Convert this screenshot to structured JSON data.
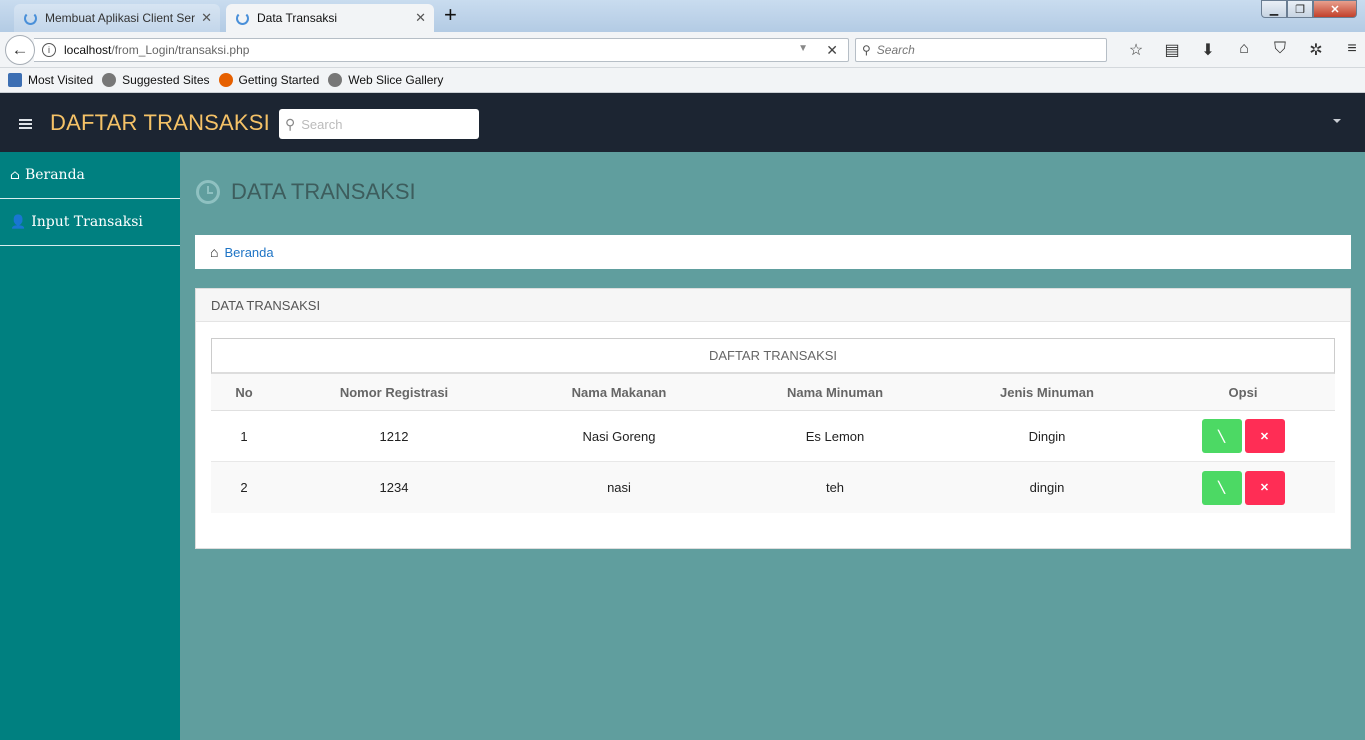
{
  "browser": {
    "tabs": [
      {
        "title": "Membuat Aplikasi Client Ser"
      },
      {
        "title": "Data Transaksi"
      }
    ],
    "url_host": "localhost",
    "url_path": "/from_Login/transaksi.php",
    "search_placeholder": "Search",
    "bookmarks": [
      "Most Visited",
      "Suggested Sites",
      "Getting Started",
      "Web Slice Gallery"
    ]
  },
  "header": {
    "brand": "DAFTAR TRANSAKSI",
    "search_placeholder": "Search"
  },
  "sidebar": {
    "items": [
      {
        "label": "Beranda",
        "icon": "home-icon"
      },
      {
        "label": "Input Transaksi",
        "icon": "user-icon"
      }
    ]
  },
  "page": {
    "title": "DATA TRANSAKSI",
    "breadcrumb": "Beranda"
  },
  "panel": {
    "heading": "DATA TRANSAKSI",
    "table_caption": "DAFTAR TRANSAKSI",
    "columns": [
      "No",
      "Nomor Registrasi",
      "Nama Makanan",
      "Nama Minuman",
      "Jenis Minuman",
      "Opsi"
    ],
    "rows": [
      {
        "no": "1",
        "reg": "1212",
        "makanan": "Nasi Goreng",
        "minuman": "Es Lemon",
        "jenis": "Dingin"
      },
      {
        "no": "2",
        "reg": "1234",
        "makanan": "nasi",
        "minuman": "teh",
        "jenis": "dingin"
      }
    ]
  },
  "colors": {
    "header_bg": "#1c2532",
    "brand": "#f5c267",
    "sidebar_bg": "#008080",
    "content_bg": "#609e9e",
    "edit_button": "#4cd964",
    "delete_button": "#ff2d55",
    "link": "#1e74c5"
  }
}
